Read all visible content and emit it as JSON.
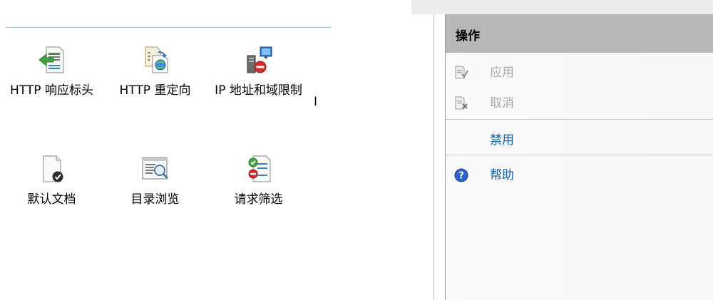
{
  "features": [
    {
      "id": "http-response-headers",
      "label": "HTTP 响应标头",
      "icon": "http-response-headers-icon"
    },
    {
      "id": "http-redirect",
      "label": "HTTP 重定向",
      "icon": "http-redirect-icon"
    },
    {
      "id": "ip-domain-restrictions",
      "label": "IP 地址和域限制",
      "icon": "ip-domain-restrictions-icon"
    },
    {
      "id": "default-document",
      "label": "默认文档",
      "icon": "default-document-icon"
    },
    {
      "id": "directory-browsing",
      "label": "目录浏览",
      "icon": "directory-browsing-icon"
    },
    {
      "id": "request-filtering",
      "label": "请求筛选",
      "icon": "request-filtering-icon"
    }
  ],
  "partial_feature_label": "I",
  "actions": {
    "title": "操作",
    "items": [
      {
        "label": "应用",
        "state": "disabled",
        "icon": "apply-icon"
      },
      {
        "label": "取消",
        "state": "disabled",
        "icon": "cancel-icon"
      },
      {
        "label": "禁用",
        "state": "link",
        "icon": ""
      },
      {
        "label": "帮助",
        "state": "link",
        "icon": "help-icon"
      }
    ]
  },
  "colors": {
    "link": "#0a5fb7",
    "disabled": "#a8a8a8",
    "header_bg": "#b8b8b8",
    "separator": "#b8c7df"
  }
}
